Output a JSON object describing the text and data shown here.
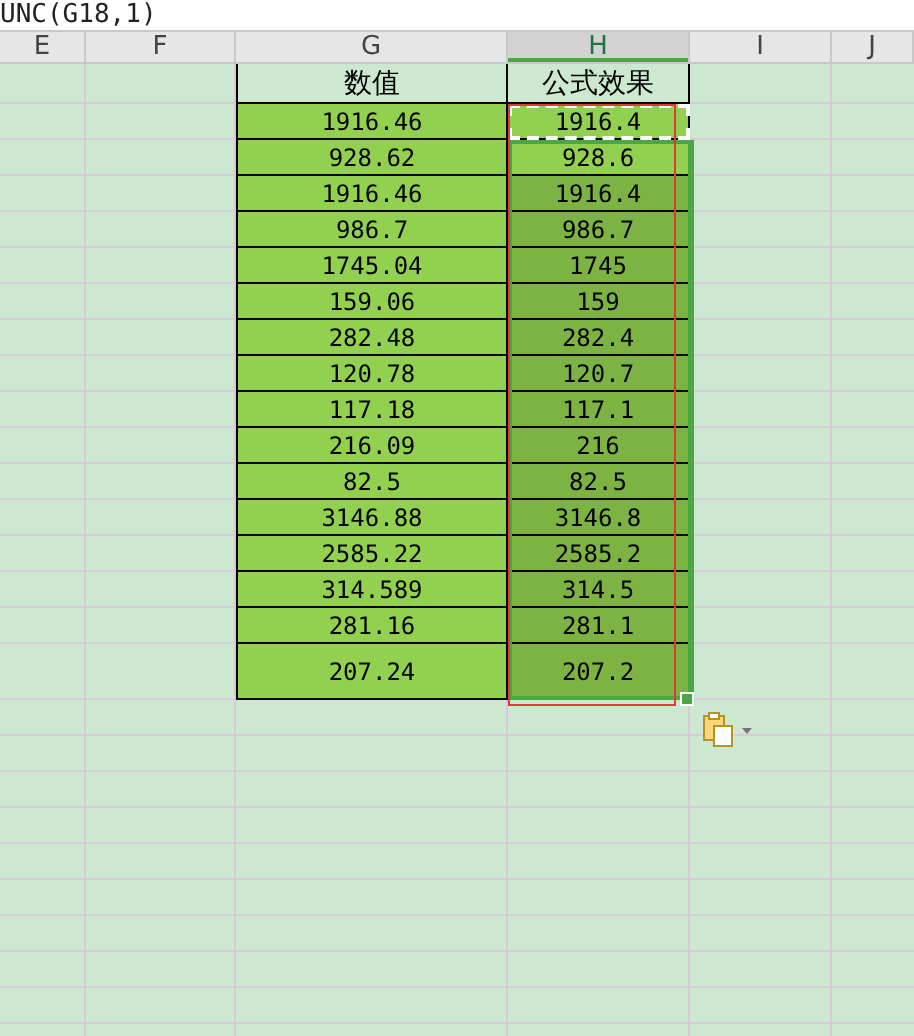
{
  "formula_bar": {
    "text": "UNC(G18,1)"
  },
  "columns": [
    {
      "label": "E",
      "selected": false
    },
    {
      "label": "F",
      "selected": false
    },
    {
      "label": "G",
      "selected": false
    },
    {
      "label": "H",
      "selected": true
    },
    {
      "label": "I",
      "selected": false
    },
    {
      "label": "J",
      "selected": false
    }
  ],
  "table": {
    "headers": [
      "数值",
      "公式效果"
    ],
    "rows": [
      {
        "value": "1916.46",
        "result": "1916.4",
        "copied": true,
        "selected": false,
        "active": false
      },
      {
        "value": "928.62",
        "result": "928.6",
        "copied": false,
        "selected": true,
        "active": true
      },
      {
        "value": "1916.46",
        "result": "1916.4",
        "copied": false,
        "selected": true,
        "active": false
      },
      {
        "value": "986.7",
        "result": "986.7",
        "copied": false,
        "selected": true,
        "active": false
      },
      {
        "value": "1745.04",
        "result": "1745",
        "copied": false,
        "selected": true,
        "active": false
      },
      {
        "value": "159.06",
        "result": "159",
        "copied": false,
        "selected": true,
        "active": false
      },
      {
        "value": "282.48",
        "result": "282.4",
        "copied": false,
        "selected": true,
        "active": false
      },
      {
        "value": "120.78",
        "result": "120.7",
        "copied": false,
        "selected": true,
        "active": false
      },
      {
        "value": "117.18",
        "result": "117.1",
        "copied": false,
        "selected": true,
        "active": false
      },
      {
        "value": "216.09",
        "result": "216",
        "copied": false,
        "selected": true,
        "active": false
      },
      {
        "value": "82.5",
        "result": "82.5",
        "copied": false,
        "selected": true,
        "active": false
      },
      {
        "value": "3146.88",
        "result": "3146.8",
        "copied": false,
        "selected": true,
        "active": false
      },
      {
        "value": "2585.22",
        "result": "2585.2",
        "copied": false,
        "selected": true,
        "active": false
      },
      {
        "value": "314.589",
        "result": "314.5",
        "copied": false,
        "selected": true,
        "active": false
      },
      {
        "value": "281.16",
        "result": "281.1",
        "copied": false,
        "selected": true,
        "active": false
      },
      {
        "value": "207.24",
        "result": "207.2",
        "copied": false,
        "selected": true,
        "active": false
      }
    ]
  }
}
